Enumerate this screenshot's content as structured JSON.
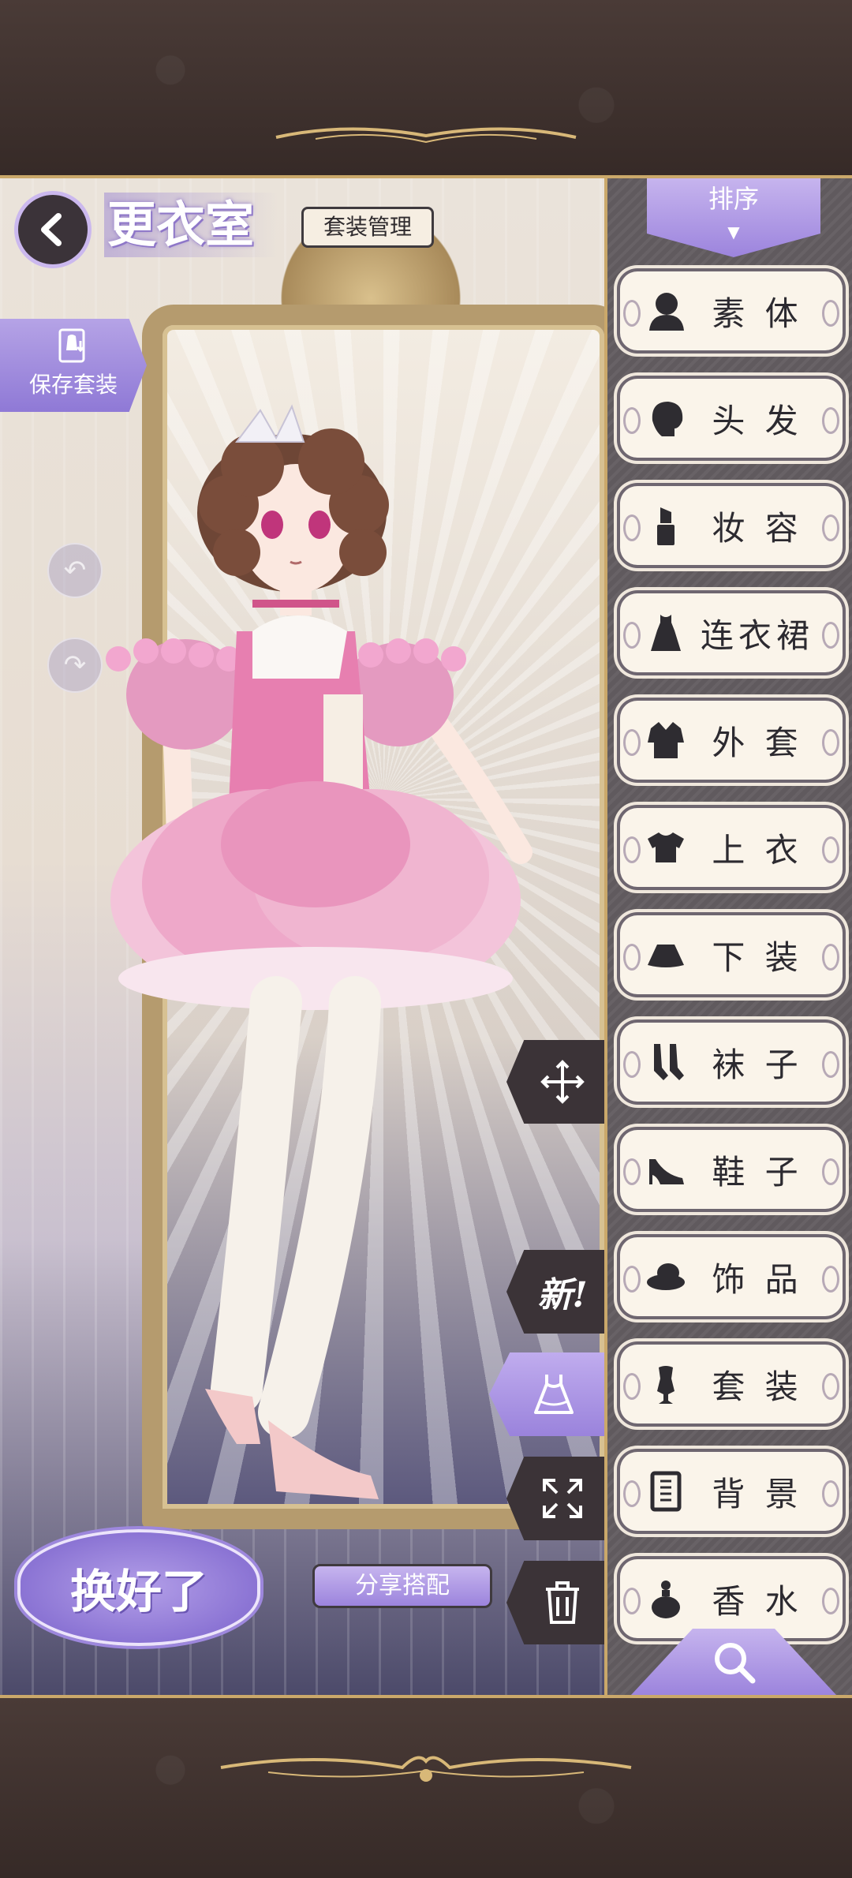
{
  "header": {
    "title": "更衣室",
    "suit_manage_label": "套装管理"
  },
  "save_outfit": {
    "label": "保存套装"
  },
  "sidebar": {
    "sort_label": "排序",
    "categories": [
      {
        "label": "素 体",
        "icon": "body-icon"
      },
      {
        "label": "头 发",
        "icon": "hair-icon"
      },
      {
        "label": "妆 容",
        "icon": "lipstick-icon"
      },
      {
        "label": "连衣裙",
        "icon": "dress-icon"
      },
      {
        "label": "外 套",
        "icon": "coat-icon"
      },
      {
        "label": "上 衣",
        "icon": "top-icon"
      },
      {
        "label": "下 装",
        "icon": "skirt-icon"
      },
      {
        "label": "袜 子",
        "icon": "socks-icon"
      },
      {
        "label": "鞋 子",
        "icon": "shoe-icon"
      },
      {
        "label": "饰 品",
        "icon": "hat-icon"
      },
      {
        "label": "套 装",
        "icon": "mannequin-icon"
      },
      {
        "label": "背 景",
        "icon": "background-icon"
      },
      {
        "label": "香 水",
        "icon": "perfume-icon"
      }
    ]
  },
  "tools": {
    "new_label": "新!"
  },
  "bottom": {
    "done_label": "换好了",
    "share_label": "分享搭配"
  },
  "colors": {
    "accent_purple": "#9c84dd",
    "frame_dark": "#3b2f2c",
    "gold": "#caa86a",
    "button_cream": "#faf4ea"
  }
}
